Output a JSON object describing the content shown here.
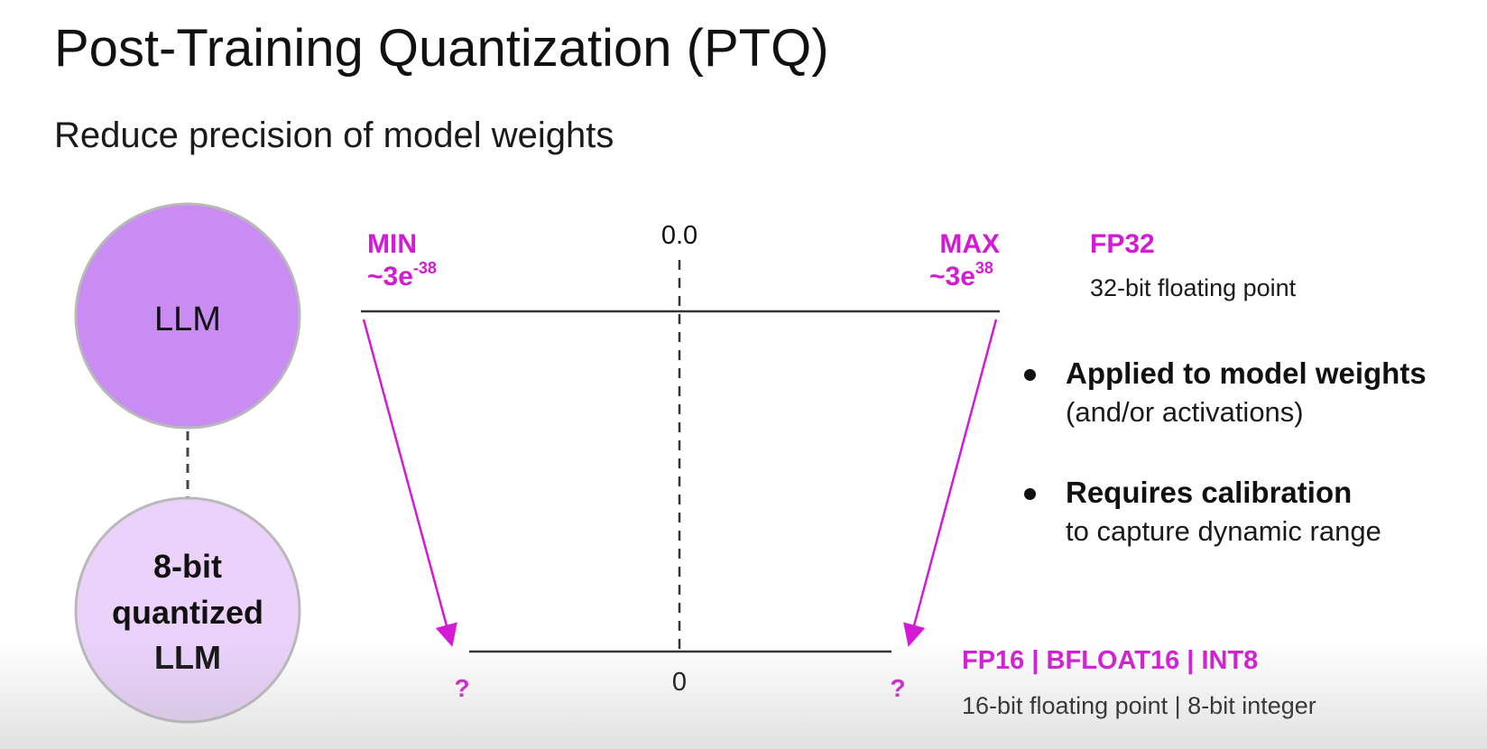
{
  "slide": {
    "title": "Post-Training Quantization (PTQ)",
    "subtitle": "Reduce precision of model weights"
  },
  "models": {
    "top_label": "LLM",
    "bottom_label_lines": [
      "8-bit",
      "quantized",
      "LLM"
    ]
  },
  "ranges": {
    "top": {
      "min_label": "MIN",
      "min_value_base": "~3e",
      "min_value_exp": "-38",
      "zero_label": "0.0",
      "max_label": "MAX",
      "max_value_base": "~3e",
      "max_value_exp": "38",
      "format_name": "FP32",
      "format_desc": "32-bit floating point"
    },
    "bottom": {
      "left_label": "?",
      "zero_label": "0",
      "right_label": "?",
      "format_name": "FP16 | BFLOAT16 | INT8",
      "format_desc": "16-bit floating point | 8-bit integer"
    }
  },
  "bullets": [
    {
      "head": "Applied to model weights",
      "sub": "(and/or activations)"
    },
    {
      "head": "Requires calibration",
      "sub": "to capture dynamic range"
    }
  ],
  "colors": {
    "magenta": "#d41ad4",
    "llm_fill": "#c98cf2",
    "quantized_fill": "#ead2fb",
    "circle_stroke": "#b9b9b9",
    "line": "#333333"
  }
}
